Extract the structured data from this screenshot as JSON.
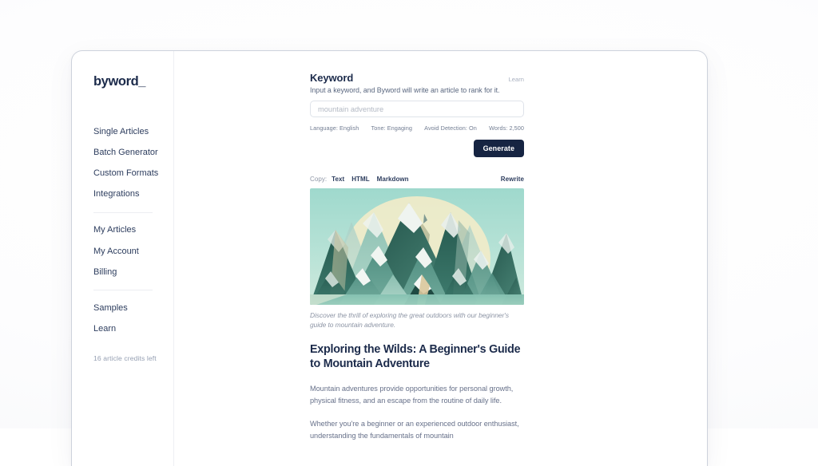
{
  "sidebar": {
    "brand": "byword_",
    "groups": [
      {
        "items": [
          {
            "label": "Single Articles",
            "name": "single-articles"
          },
          {
            "label": "Batch Generator",
            "name": "batch-generator"
          },
          {
            "label": "Custom Formats",
            "name": "custom-formats"
          },
          {
            "label": "Integrations",
            "name": "integrations"
          }
        ]
      },
      {
        "items": [
          {
            "label": "My Articles",
            "name": "my-articles"
          },
          {
            "label": "My Account",
            "name": "my-account"
          },
          {
            "label": "Billing",
            "name": "billing"
          }
        ]
      },
      {
        "items": [
          {
            "label": "Samples",
            "name": "samples"
          },
          {
            "label": "Learn",
            "name": "learn"
          }
        ]
      }
    ],
    "credits": "16 article credits left"
  },
  "keyword": {
    "title": "Keyword",
    "learn_link": "Learn",
    "subtitle": "Input a keyword, and Byword will write an article to rank for it.",
    "input_value": "",
    "input_placeholder": "mountain adventure",
    "meta": [
      "Language: English",
      "Tone: Engaging",
      "Avoid Detection: On",
      "Words: 2,500"
    ],
    "generate_label": "Generate"
  },
  "copybar": {
    "label": "Copy:",
    "options": [
      "Text",
      "HTML",
      "Markdown"
    ],
    "rewrite_label": "Rewrite"
  },
  "article": {
    "image_alt": "mountain-range-illustration",
    "caption": "Discover the thrill of exploring the great outdoors with our beginner's guide to mountain adventure.",
    "title": "Exploring the Wilds: A Beginner's Guide to Mountain Adventure",
    "paragraphs": [
      "Mountain adventures provide opportunities for personal growth, physical fitness, and an escape from the routine of daily life.",
      "Whether you're a beginner or an experienced outdoor enthusiast, understanding the fundamentals of mountain"
    ]
  },
  "colors": {
    "brand_navy": "#1c2b4b",
    "button_navy": "#162442",
    "muted_text": "#67718a",
    "sky_teal": "#a8ded2",
    "sun_cream": "#f2ecc8",
    "mountain_dark": "#2c5b52",
    "mountain_mid": "#58988a",
    "mountain_light": "#8fc4b6",
    "snow": "#f3f6f4"
  }
}
